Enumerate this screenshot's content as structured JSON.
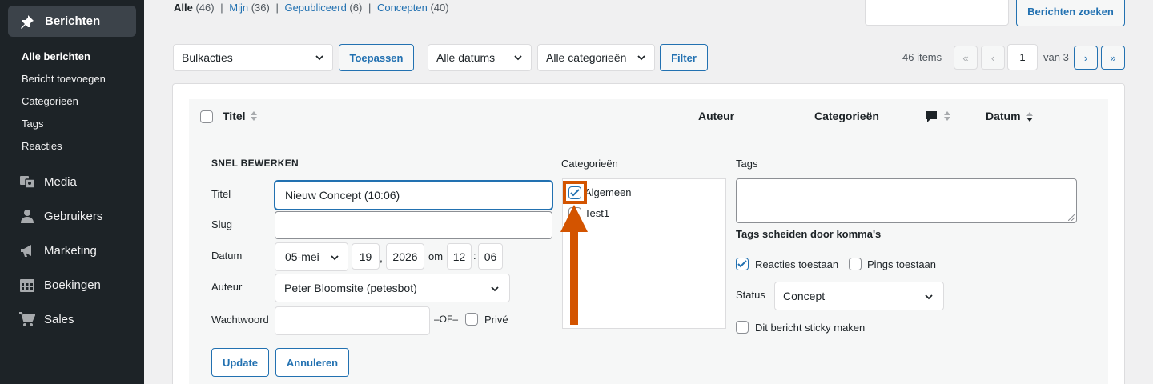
{
  "sidebar": {
    "active": {
      "label": "Berichten",
      "icon": "pin-icon"
    },
    "submenu": [
      {
        "label": "Alle berichten",
        "current": true
      },
      {
        "label": "Bericht toevoegen",
        "current": false
      },
      {
        "label": "Categorieën",
        "current": false
      },
      {
        "label": "Tags",
        "current": false
      },
      {
        "label": "Reacties",
        "current": false
      }
    ],
    "items": [
      {
        "label": "Media",
        "icon": "media-icon"
      },
      {
        "label": "Gebruikers",
        "icon": "users-icon"
      },
      {
        "label": "Marketing",
        "icon": "megaphone-icon"
      },
      {
        "label": "Boekingen",
        "icon": "calendar-icon"
      },
      {
        "label": "Sales",
        "icon": "cart-icon"
      }
    ]
  },
  "filters": {
    "all": "Alle",
    "all_count": "(46)",
    "mine": "Mijn",
    "mine_count": "(36)",
    "published": "Gepubliceerd",
    "published_count": "(6)",
    "drafts": "Concepten",
    "drafts_count": "(40)",
    "sep": "|"
  },
  "search": {
    "button": "Berichten zoeken"
  },
  "toolbar": {
    "bulk": "Bulkacties",
    "apply": "Toepassen",
    "dates": "Alle datums",
    "categories": "Alle categorieën",
    "filter": "Filter"
  },
  "pagination": {
    "items": "46 items",
    "first": "«",
    "prev": "‹",
    "next": "›",
    "last": "»",
    "page": "1",
    "of": "van 3"
  },
  "table": {
    "headers": {
      "title": "Titel",
      "author": "Auteur",
      "categories": "Categorieën",
      "date": "Datum"
    }
  },
  "quick_edit": {
    "heading": "SNEL BEWERKEN",
    "title_label": "Titel",
    "title_value": "Nieuw Concept (10:06)",
    "slug_label": "Slug",
    "slug_value": "",
    "date_label": "Datum",
    "month": "05-mei",
    "day": "19",
    "comma": ",",
    "year": "2026",
    "at": "om",
    "hour": "12",
    "colon": ":",
    "minute": "06",
    "author_label": "Auteur",
    "author_value": "Peter Bloomsite (petesbot)",
    "password_label": "Wachtwoord",
    "or": "–OF–",
    "private": "Privé",
    "categories_label": "Categorieën",
    "categories": [
      {
        "label": "Algemeen",
        "checked": true
      },
      {
        "label": "Test1",
        "checked": false
      }
    ],
    "tags_label": "Tags",
    "tags_hint": "Tags scheiden door komma's",
    "allow_comments": "Reacties toestaan",
    "allow_pings": "Pings toestaan",
    "status_label": "Status",
    "status_value": "Concept",
    "sticky": "Dit bericht sticky maken",
    "update": "Update",
    "cancel": "Annuleren"
  },
  "colors": {
    "accent": "#2271b1",
    "highlight": "#d35400",
    "sidebar_bg": "#1d2327"
  }
}
